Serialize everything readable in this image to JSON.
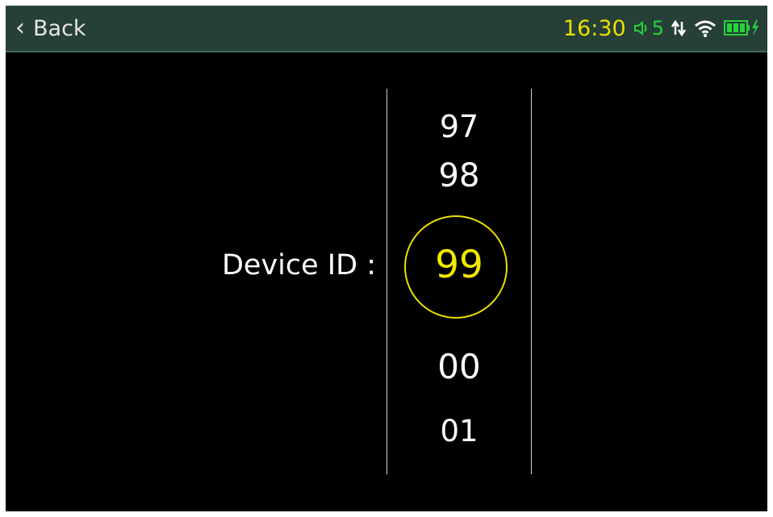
{
  "topbar": {
    "back_label": "Back",
    "time": "16:30",
    "volume_level": "5",
    "icons": [
      "chevron-left-icon",
      "speaker-icon",
      "data-transfer-icon",
      "wifi-icon",
      "battery-charging-icon"
    ],
    "colors": {
      "bar_bg": "#263f37",
      "time": "#e8e000",
      "status_green": "#27d23a"
    }
  },
  "main": {
    "field_label": "Device ID :",
    "picker": {
      "values": [
        "97",
        "98",
        "99",
        "00",
        "01"
      ],
      "selected": "99",
      "highlight_color": "#f2ea00"
    }
  }
}
